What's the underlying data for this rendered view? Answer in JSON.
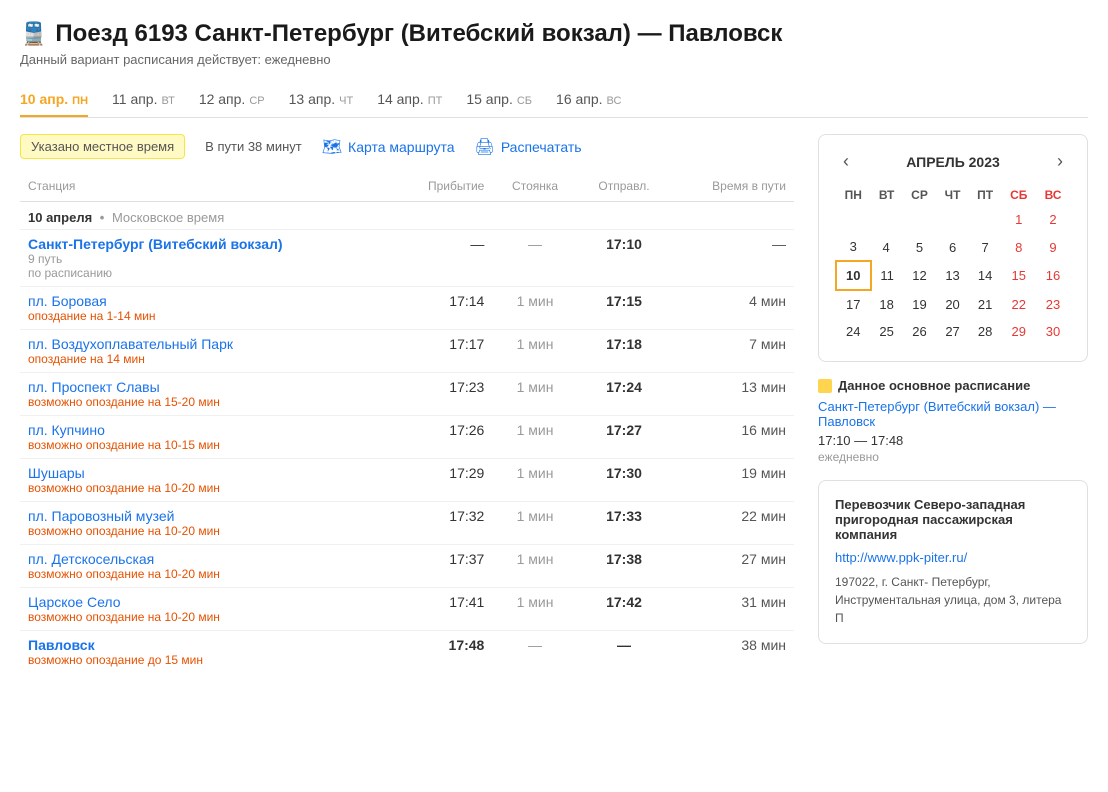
{
  "header": {
    "icon": "🚆",
    "title": "Поезд 6193 Санкт-Петербург (Витебский вокзал) — Павловск",
    "note": "Данный вариант расписания действует: ежедневно"
  },
  "tabs": [
    {
      "date": "10 апр.",
      "day": "пн",
      "active": true
    },
    {
      "date": "11 апр.",
      "day": "вт",
      "active": false
    },
    {
      "date": "12 апр.",
      "day": "ср",
      "active": false
    },
    {
      "date": "13 апр.",
      "day": "чт",
      "active": false
    },
    {
      "date": "14 апр.",
      "day": "пт",
      "active": false
    },
    {
      "date": "15 апр.",
      "day": "сб",
      "active": false
    },
    {
      "date": "16 апр.",
      "day": "вс",
      "active": false
    }
  ],
  "toolbar": {
    "local_time": "Указано местное время",
    "travel_time": "В пути 38 минут",
    "map_label": "Карта маршрута",
    "print_label": "Распечатать"
  },
  "table": {
    "columns": {
      "station": "Станция",
      "arrival": "Прибытие",
      "stop": "Стоянка",
      "departure": "Отправл.",
      "travel": "Время в пути"
    },
    "date_row": {
      "date": "10 апреля",
      "timezone": "Московское время"
    },
    "stations": [
      {
        "name": "Санкт-Петербург (Витебский вокзал)",
        "bold": true,
        "sub1": "9 путь",
        "sub2": "по расписанию",
        "sub2_orange": false,
        "arrival": "—",
        "stop": "—",
        "departure": "17:10",
        "travel": "—"
      },
      {
        "name": "пл. Боровая",
        "bold": false,
        "sub1": "опоздание на 1-14 мин",
        "sub1_orange": true,
        "arrival": "17:14",
        "stop": "1 мин",
        "departure": "17:15",
        "travel": "4 мин"
      },
      {
        "name": "пл. Воздухоплавательный Парк",
        "bold": false,
        "sub1": "опоздание на 14 мин",
        "sub1_orange": true,
        "arrival": "17:17",
        "stop": "1 мин",
        "departure": "17:18",
        "travel": "7 мин"
      },
      {
        "name": "пл. Проспект Славы",
        "bold": false,
        "sub1": "возможно опоздание на 15-20 мин",
        "sub1_orange": true,
        "arrival": "17:23",
        "stop": "1 мин",
        "departure": "17:24",
        "travel": "13 мин"
      },
      {
        "name": "пл. Купчино",
        "bold": false,
        "sub1": "возможно опоздание на 10-15 мин",
        "sub1_orange": true,
        "arrival": "17:26",
        "stop": "1 мин",
        "departure": "17:27",
        "travel": "16 мин"
      },
      {
        "name": "Шушары",
        "bold": false,
        "sub1": "возможно опоздание на 10-20 мин",
        "sub1_orange": true,
        "arrival": "17:29",
        "stop": "1 мин",
        "departure": "17:30",
        "travel": "19 мин"
      },
      {
        "name": "пл. Паровозный музей",
        "bold": false,
        "sub1": "возможно опоздание на 10-20 мин",
        "sub1_orange": true,
        "arrival": "17:32",
        "stop": "1 мин",
        "departure": "17:33",
        "travel": "22 мин"
      },
      {
        "name": "пл. Детскосельская",
        "bold": false,
        "sub1": "возможно опоздание на 10-20 мин",
        "sub1_orange": true,
        "arrival": "17:37",
        "stop": "1 мин",
        "departure": "17:38",
        "travel": "27 мин"
      },
      {
        "name": "Царское Село",
        "bold": false,
        "sub1": "возможно опоздание на 10-20 мин",
        "sub1_orange": true,
        "arrival": "17:41",
        "stop": "1 мин",
        "departure": "17:42",
        "travel": "31 мин"
      },
      {
        "name": "Павловск",
        "bold": true,
        "sub1": "возможно опоздание до 15 мин",
        "sub1_orange": true,
        "arrival": "17:48",
        "stop": "—",
        "departure": "—",
        "travel": "38 мин"
      }
    ]
  },
  "calendar": {
    "month": "АПРЕЛЬ 2023",
    "weekdays": [
      "ПН",
      "ВТ",
      "СР",
      "ЧТ",
      "ПТ",
      "СБ",
      "ВС"
    ],
    "weekend_cols": [
      5,
      6
    ],
    "weeks": [
      [
        null,
        null,
        null,
        null,
        null,
        1,
        2
      ],
      [
        3,
        4,
        5,
        6,
        7,
        8,
        9
      ],
      [
        10,
        11,
        12,
        13,
        14,
        15,
        16
      ],
      [
        17,
        18,
        19,
        20,
        21,
        22,
        23
      ],
      [
        24,
        25,
        26,
        27,
        28,
        29,
        30
      ]
    ],
    "today": 10
  },
  "schedule_info": {
    "title": "Данное основное расписание",
    "route_link": "Санкт-Петербург (Витебский вокзал) — Павловск",
    "times": "17:10 — 17:48",
    "frequency": "ежедневно"
  },
  "carrier": {
    "title": "Перевозчик Северо-западная пригородная пассажирская компания",
    "link": "http://www.ppk-piter.ru/",
    "address": "197022, г. Санкт- Петербург, Инструментальная улица, дом 3, литера П"
  }
}
